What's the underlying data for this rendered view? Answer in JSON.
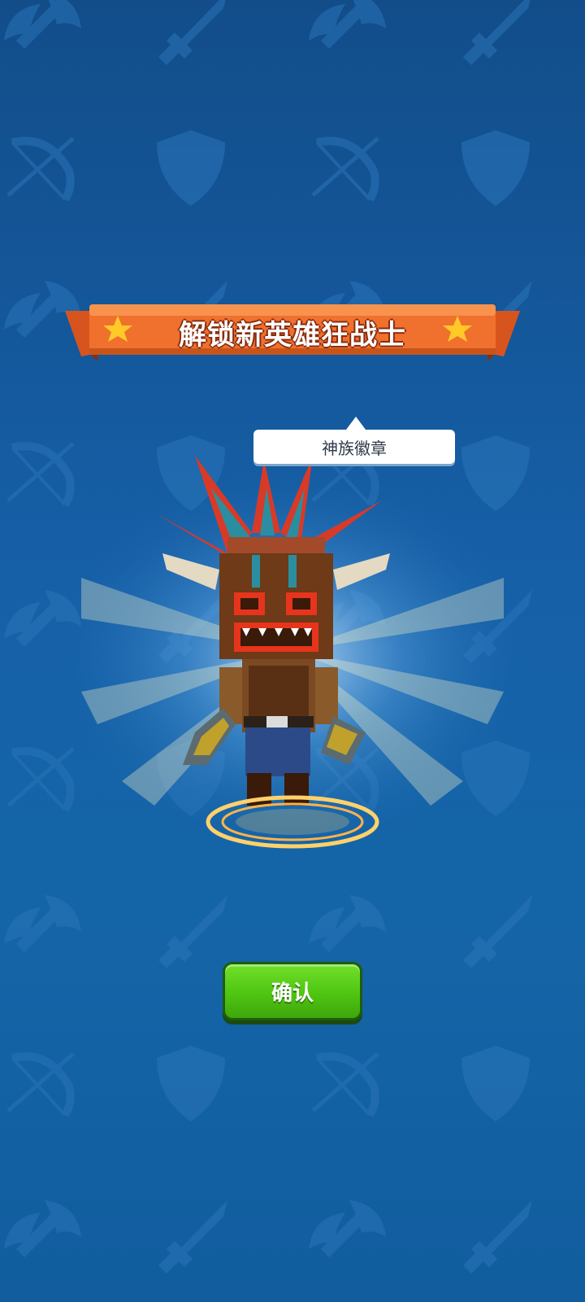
{
  "banner": {
    "title": "解锁新英雄狂战士"
  },
  "tooltip": {
    "label": "神族徽章"
  },
  "actions": {
    "confirm_label": "确认"
  },
  "colors": {
    "background": "#1660a8",
    "banner": "#f0702e",
    "confirm_button": "#4fc512"
  },
  "icons": [
    "axe-icon",
    "sword-icon",
    "bow-icon",
    "shield-icon",
    "star-icon"
  ]
}
